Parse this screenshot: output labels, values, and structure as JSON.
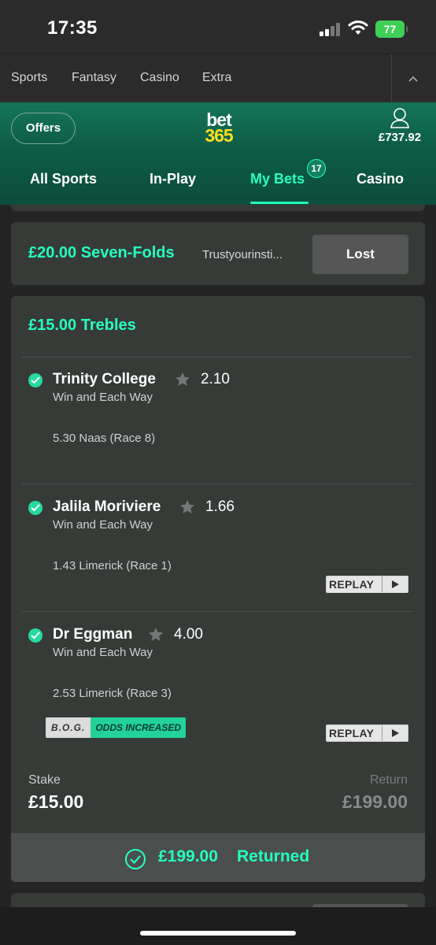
{
  "status_bar": {
    "time": "17:35",
    "battery": "77"
  },
  "top_nav": {
    "items": [
      "Sports",
      "Fantasy",
      "Casino",
      "Extra"
    ]
  },
  "header": {
    "offers_label": "Offers",
    "logo_top": "bet",
    "logo_bottom": "365",
    "balance": "£737.92",
    "tabs": [
      "All Sports",
      "In-Play",
      "My Bets",
      "Casino"
    ],
    "active_tab": "My Bets",
    "my_bets_count": "17"
  },
  "bets": [
    {
      "title": "£20.00 Seven-Folds",
      "subtitle": "Trustyourinsti...",
      "result_label": "Lost"
    },
    {
      "title": "£15.00 Trebles",
      "selections": [
        {
          "name": "Trinity College",
          "odds": "2.10",
          "market": "Win and Each Way",
          "race": "5.30 Naas (Race 8)",
          "replay": false
        },
        {
          "name": "Jalila Moriviere",
          "odds": "1.66",
          "market": "Win and Each Way",
          "race": "1.43 Limerick (Race 1)",
          "replay": true
        },
        {
          "name": "Dr Eggman",
          "odds": "4.00",
          "market": "Win and Each Way",
          "race": "2.53 Limerick (Race 3)",
          "replay": true
        }
      ],
      "bog_label": "B.O.G.",
      "odds_increased_label": "ODDS INCREASED",
      "replay_label": "REPLAY",
      "stake_label": "Stake",
      "stake": "£15.00",
      "return_label": "Return",
      "return": "£199.00",
      "returned_amount": "£199.00",
      "returned_label": "Returned"
    }
  ],
  "colors": {
    "accent": "#26ffbe",
    "header_green": "#0e5c45",
    "logo_yellow": "#ffdf1b",
    "card": "#363b38"
  }
}
